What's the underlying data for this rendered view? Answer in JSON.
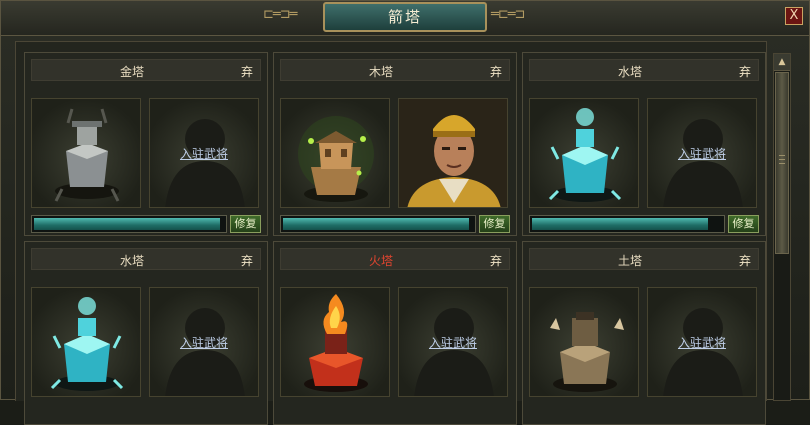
{
  "window": {
    "title": "箭塔",
    "close_label": "X"
  },
  "cards": [
    {
      "name": "金塔",
      "discard": "弃",
      "general": null,
      "enter_label": "入驻武将",
      "hp": 0.96,
      "repair": "修复",
      "element": "gold",
      "name_color": "#e8dcc0"
    },
    {
      "name": "木塔",
      "discard": "弃",
      "general": "occupied",
      "enter_label": "",
      "hp": 0.96,
      "repair": "修复",
      "element": "wood",
      "name_color": "#e8dcc0"
    },
    {
      "name": "水塔",
      "discard": "弃",
      "general": null,
      "enter_label": "入驻武将",
      "hp": 0.91,
      "repair": "修复",
      "element": "water",
      "name_color": "#e8dcc0"
    },
    {
      "name": "水塔",
      "discard": "弃",
      "general": null,
      "enter_label": "入驻武将",
      "hp": null,
      "repair": "",
      "element": "water",
      "name_color": "#e8dcc0"
    },
    {
      "name": "火塔",
      "discard": "弃",
      "general": null,
      "enter_label": "入驻武将",
      "hp": null,
      "repair": "",
      "element": "fire",
      "name_color": "#e04530"
    },
    {
      "name": "土塔",
      "discard": "弃",
      "general": null,
      "enter_label": "入驻武将",
      "hp": null,
      "repair": "",
      "element": "earth",
      "name_color": "#e8dcc0"
    }
  ],
  "icons": {
    "close": "close-icon",
    "scroll_up": "arrow-up-icon",
    "ornament": "cloud-scroll-ornament"
  }
}
